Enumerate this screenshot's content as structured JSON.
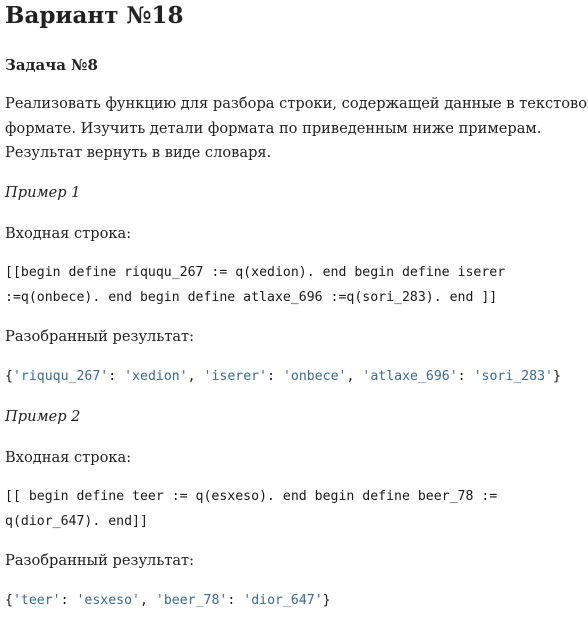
{
  "heading": "Вариант №18",
  "task_title": "Задача №8",
  "description_lines": [
    "Реализовать функцию для разбора строки, содержащей данные в текстовом",
    "формате. Изучить детали формата по приведенным ниже примерам.",
    "Результат вернуть в виде словаря."
  ],
  "examples": [
    {
      "title": "Пример 1",
      "input_label": "Входная строка:",
      "input_lines": [
        "[[begin define riququ_267 := q(xedion). end begin define iserer",
        ":=q(onbece). end begin define atlaxe_696 :=q(sori_283). end ]]"
      ],
      "result_label": "Разобранный результат:",
      "result": [
        {
          "key": "'riququ_267'",
          "value": "'xedion'"
        },
        {
          "key": "'iserer'",
          "value": "'onbece'"
        },
        {
          "key": "'atlaxe_696'",
          "value": "'sori_283'"
        }
      ]
    },
    {
      "title": "Пример 2",
      "input_label": "Входная строка:",
      "input_lines": [
        "[[ begin define teer := q(esxeso). end begin define beer_78 :=",
        "q(dior_647). end]]"
      ],
      "result_label": "Разобранный результат:",
      "result": [
        {
          "key": "'teer'",
          "value": "'esxeso'"
        },
        {
          "key": "'beer_78'",
          "value": "'dior_647'"
        }
      ]
    }
  ],
  "colors": {
    "text": "#222222",
    "string_literal": "#3b6b91"
  }
}
